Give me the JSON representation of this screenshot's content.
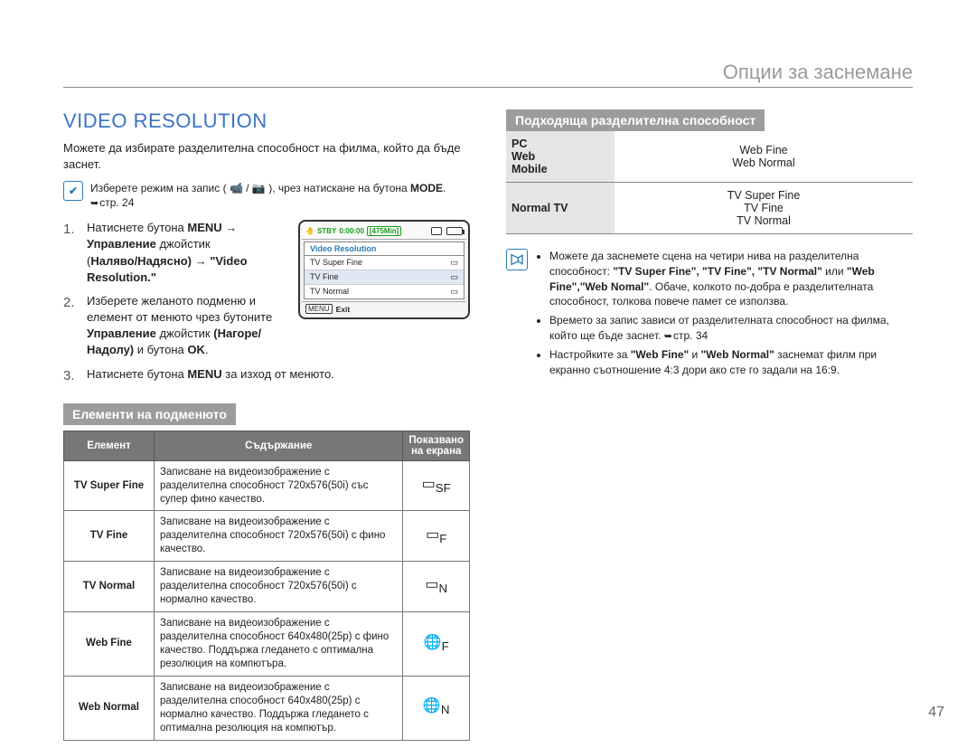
{
  "header": {
    "title": "Опции за заснемане"
  },
  "main": {
    "heading": "VIDEO RESOLUTION",
    "intro": "Можете да избирате разделителна способност на филма, който да бъде заснет.",
    "precheck": {
      "text_before": "Изберете режим на запис (",
      "text_mid": " / ",
      "text_after": "), чрез натискане на бутона ",
      "mode_word": "MODE",
      "page_ref": "стр. 24"
    },
    "steps": [
      {
        "n": "1.",
        "p1a": "Натиснете бутона ",
        "p1b": "MENU",
        "p1c": " → ",
        "p2a": "Управление",
        "p2b": " джойстик ",
        "p3a": "Наляво/Надясно) → \"Video Resolution.\"",
        "p0_open": "("
      },
      {
        "n": "2.",
        "p1": "Изберете желаното подменю и елемент от менюто чрез бутоните ",
        "p2a": "Управление",
        "p2b": " джойстик ",
        "p3a": "(Нагоре/Надолу)",
        "p3b": " и бутона ",
        "p3c": "OK",
        "p3d": "."
      },
      {
        "n": "3.",
        "p1": "Натиснете бутона ",
        "p2": "MENU",
        "p3": " за изход от менюто."
      }
    ],
    "camera_lcd": {
      "stby": "STBY",
      "tc": "0:00:00",
      "remain": "[475Min]",
      "menu_title": "Video Resolution",
      "items": [
        "TV Super Fine",
        "TV Fine",
        "TV Normal"
      ],
      "footer_menu": "MENU",
      "footer_exit": "Exit"
    },
    "submenu": {
      "title": "Елементи на подменюто",
      "headers": {
        "item": "Елемент",
        "content": "Съдържание",
        "screen": "Показвано на екрана"
      },
      "rows": [
        {
          "name": "TV Super Fine",
          "desc": "Записване на видеоизображение с разделителна способност 720x576(50i) със супер фино качество.",
          "icon": "tv-sf-icon"
        },
        {
          "name": "TV Fine",
          "desc": "Записване на видеоизображение с разделителна способност 720x576(50i) с фино качество.",
          "icon": "tv-f-icon"
        },
        {
          "name": "TV Normal",
          "desc": "Записване на видеоизображение с разделителна способност 720x576(50i) с нормално качество.",
          "icon": "tv-n-icon"
        },
        {
          "name": "Web Fine",
          "desc": "Записване на видеоизображение с разделителна способност 640x480(25p) с фино качество. Поддържа гледането с оптимална резолюция на компютъра.",
          "icon": "web-f-icon"
        },
        {
          "name": "Web Normal",
          "desc": "Записване на видеоизображение с разделителна способност  640x480(25p) с нормално качество. Поддържа гледането с оптимална резолюция на компютър.",
          "icon": "web-n-icon"
        }
      ]
    }
  },
  "right": {
    "section_title": "Подходяща разделителна способност",
    "rows": [
      {
        "label_lines": [
          "PC",
          "Web",
          "Mobile"
        ],
        "values": [
          "Web Fine",
          "Web Normal"
        ]
      },
      {
        "label_lines": [
          "Normal TV"
        ],
        "values": [
          "TV Super Fine",
          "TV Fine",
          "TV Normal"
        ]
      }
    ],
    "notes": [
      {
        "pre": "Можете да заснемете сцена на четири нива на разделителна способност: ",
        "bold1": "\"TV Super Fine\", \"TV Fine\", \"TV Normal\"",
        "mid": " или ",
        "bold2": "\"Web Fine\",\"Web Nomal\"",
        "post": ". Обаче, колкото по-добра е разделителната способност, толкова повече памет се използва."
      },
      {
        "pre": "Времето за запис зависи от разделителната способност на филма, който ще бъде заснет. ",
        "ref": "стр. 34"
      },
      {
        "pre": "Настройките за ",
        "bold1": "\"Web Fine\"",
        "mid": " и ",
        "bold2": "\"Web Normal\"",
        "post": " заснемат филм при екранно съотношение 4:3 дори ако сте го задали на 16:9."
      }
    ]
  },
  "page_number": "47"
}
